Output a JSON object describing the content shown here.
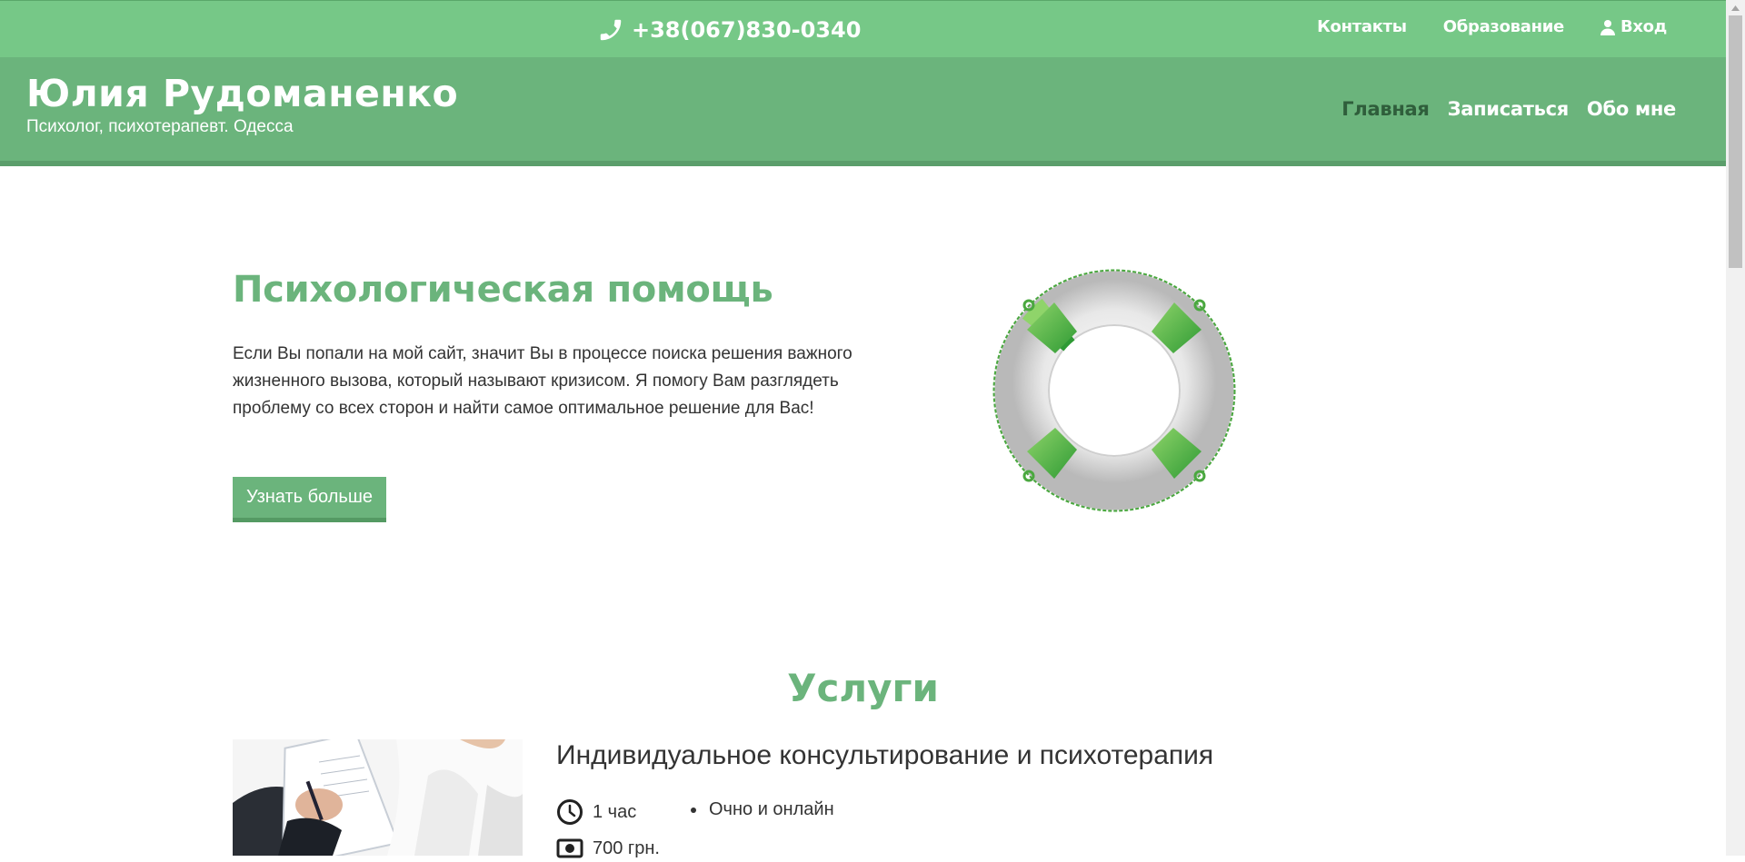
{
  "topbar": {
    "phone": "+38(067)830-0340",
    "links": [
      "Контакты",
      "Образование",
      "Вход"
    ]
  },
  "header": {
    "name": "Юлия Рудоманенко",
    "subtitle": "Психолог, психотерапевт. Одесса",
    "nav": [
      "Главная",
      "Записаться",
      "Обо мне"
    ],
    "active_nav": "Главная"
  },
  "hero": {
    "title": "Психологическая помощь",
    "text": "Если Вы попали на мой сайт, значит Вы в процессе поиска решения важного жизненного вызова, который называют кризисом. Я помогу Вам разглядеть проблему со всех сторон и найти самое оптимальное решение для Вас!",
    "button": "Узнать больше"
  },
  "services": {
    "title": "Услуги",
    "items": [
      {
        "title": "Индивидуальное консультирование и психотерапия",
        "duration": "1 час",
        "format": "Очно и онлайн",
        "price": "700 грн."
      }
    ]
  },
  "colors": {
    "topbar": "#76c887",
    "header": "#6bb47c",
    "accent": "#6bb47c",
    "active_nav": "#2f5e3b"
  },
  "icons": [
    "phone-icon",
    "user-icon",
    "lifebuoy-image",
    "clock-icon",
    "money-icon"
  ]
}
